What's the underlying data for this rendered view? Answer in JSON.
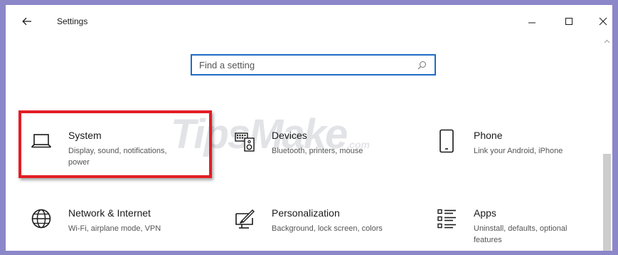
{
  "window": {
    "title": "Settings",
    "back_icon": "arrow-left-icon",
    "minimize_icon": "minimize-icon",
    "maximize_icon": "maximize-icon",
    "close_icon": "close-icon"
  },
  "search": {
    "placeholder": "Find a setting",
    "value": "",
    "icon": "search-icon"
  },
  "watermark": {
    "text": "TipsMake",
    "suffix": ".com"
  },
  "categories": [
    {
      "icon": "laptop-icon",
      "title": "System",
      "description": "Display, sound, notifications, power"
    },
    {
      "icon": "keyboard-speaker-icon",
      "title": "Devices",
      "description": "Bluetooth, printers, mouse"
    },
    {
      "icon": "phone-icon",
      "title": "Phone",
      "description": "Link your Android, iPhone"
    },
    {
      "icon": "globe-icon",
      "title": "Network & Internet",
      "description": "Wi-Fi, airplane mode, VPN"
    },
    {
      "icon": "paint-brush-icon",
      "title": "Personalization",
      "description": "Background, lock screen, colors"
    },
    {
      "icon": "apps-list-icon",
      "title": "Apps",
      "description": "Uninstall, defaults, optional features"
    }
  ],
  "colors": {
    "accent": "#1f6cc4",
    "highlight_border": "#e31e24",
    "frame": "#8b87c9",
    "icon": "#1a1a1a"
  }
}
